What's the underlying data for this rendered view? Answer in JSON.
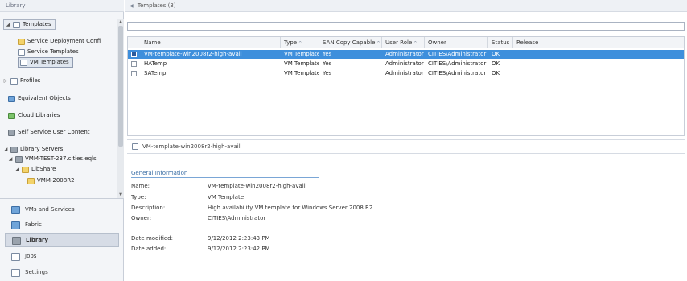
{
  "library_header": "Library",
  "tree": {
    "templates": "Templates",
    "service_deployment_configs": "Service Deployment Confi",
    "service_templates": "Service Templates",
    "vm_templates": "VM Templates",
    "profiles": "Profiles",
    "equivalent_objects": "Equivalent Objects",
    "cloud_libraries": "Cloud Libraries",
    "self_service_user_content": "Self Service User Content",
    "library_servers": "Library Servers",
    "vmm_server": "VMM-TEST-237.cities.eqls",
    "libshare": "LibShare",
    "vmm_folder": "VMM-2008R2"
  },
  "nav": {
    "vms_and_services": "VMs and Services",
    "fabric": "Fabric",
    "library": "Library",
    "jobs": "Jobs",
    "settings": "Settings"
  },
  "breadcrumb": "Templates (3)",
  "search": {
    "value": "",
    "placeholder": ""
  },
  "grid": {
    "columns": [
      "Name",
      "Type",
      "SAN Copy Capable",
      "User Role",
      "Owner",
      "Status",
      "Release"
    ],
    "rows": [
      [
        "VM-template-win2008r2-high-avail",
        "VM Template",
        "Yes",
        "Administrator",
        "CITIES\\Administrator",
        "OK",
        ""
      ],
      [
        "HATemp",
        "VM Template",
        "Yes",
        "Administrator",
        "CITIES\\Administrator",
        "OK",
        ""
      ],
      [
        "SATemp",
        "VM Template",
        "Yes",
        "Administrator",
        "CITIES\\Administrator",
        "OK",
        ""
      ]
    ]
  },
  "detail": {
    "title": "VM-template-win2008r2-high-avail",
    "section": "General Information",
    "labels": {
      "name": "Name:",
      "type": "Type:",
      "description": "Description:",
      "owner": "Owner:",
      "date_modified": "Date modified:",
      "date_added": "Date added:"
    },
    "values": {
      "name": "VM-template-win2008r2-high-avail",
      "type": "VM Template",
      "description": "High availability VM template for Windows Server 2008 R2.",
      "owner": "CITIES\\Administrator",
      "date_modified": "9/12/2012 2:23:43 PM",
      "date_added": "9/12/2012 2:23:42 PM"
    }
  },
  "colors": {
    "selection": "#3e8fdc",
    "section_heading": "#3a6ea5"
  }
}
